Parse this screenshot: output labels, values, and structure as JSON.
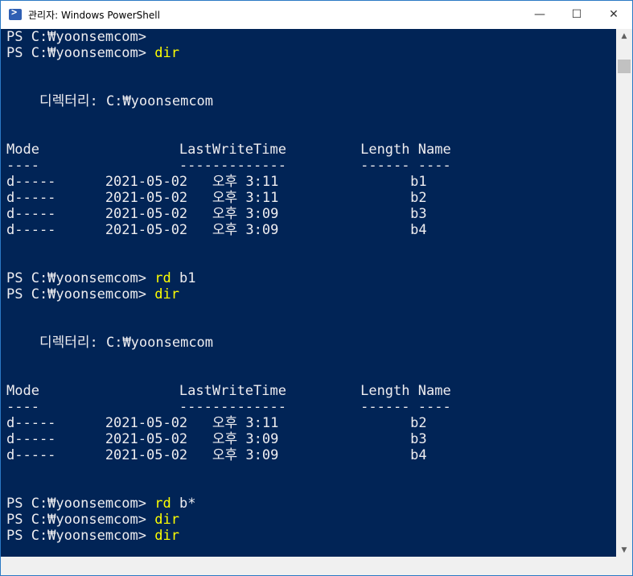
{
  "window": {
    "title": "관리자: Windows PowerShell",
    "controls": {
      "minimize": "—",
      "maximize": "☐",
      "close": "✕"
    }
  },
  "colors": {
    "console_bg": "#012456",
    "text": "#eeedf0",
    "command": "#ffff00"
  },
  "console": {
    "lines": [
      {
        "text": "PS C:₩yoonsemcom>",
        "cmd": ""
      },
      {
        "text": "PS C:₩yoonsemcom> ",
        "cmd": "dir"
      },
      {
        "text": "",
        "cmd": ""
      },
      {
        "text": "",
        "cmd": ""
      },
      {
        "text": "    디렉터리: C:₩yoonsemcom",
        "cmd": ""
      },
      {
        "text": "",
        "cmd": ""
      },
      {
        "text": "",
        "cmd": ""
      },
      {
        "text": "Mode                 LastWriteTime         Length Name",
        "cmd": ""
      },
      {
        "text": "----                 -------------         ------ ----",
        "cmd": ""
      },
      {
        "text": "d-----      2021-05-02   오후 3:11                b1",
        "cmd": ""
      },
      {
        "text": "d-----      2021-05-02   오후 3:11                b2",
        "cmd": ""
      },
      {
        "text": "d-----      2021-05-02   오후 3:09                b3",
        "cmd": ""
      },
      {
        "text": "d-----      2021-05-02   오후 3:09                b4",
        "cmd": ""
      },
      {
        "text": "",
        "cmd": ""
      },
      {
        "text": "",
        "cmd": ""
      },
      {
        "text": "PS C:₩yoonsemcom> ",
        "cmd": "rd",
        "arg": " b1"
      },
      {
        "text": "PS C:₩yoonsemcom> ",
        "cmd": "dir"
      },
      {
        "text": "",
        "cmd": ""
      },
      {
        "text": "",
        "cmd": ""
      },
      {
        "text": "    디렉터리: C:₩yoonsemcom",
        "cmd": ""
      },
      {
        "text": "",
        "cmd": ""
      },
      {
        "text": "",
        "cmd": ""
      },
      {
        "text": "Mode                 LastWriteTime         Length Name",
        "cmd": ""
      },
      {
        "text": "----                 -------------         ------ ----",
        "cmd": ""
      },
      {
        "text": "d-----      2021-05-02   오후 3:11                b2",
        "cmd": ""
      },
      {
        "text": "d-----      2021-05-02   오후 3:09                b3",
        "cmd": ""
      },
      {
        "text": "d-----      2021-05-02   오후 3:09                b4",
        "cmd": ""
      },
      {
        "text": "",
        "cmd": ""
      },
      {
        "text": "",
        "cmd": ""
      },
      {
        "text": "PS C:₩yoonsemcom> ",
        "cmd": "rd",
        "arg": " b*"
      },
      {
        "text": "PS C:₩yoonsemcom> ",
        "cmd": "dir"
      },
      {
        "text": "PS C:₩yoonsemcom> ",
        "cmd": "dir"
      }
    ]
  },
  "scrollbar": {
    "up_icon": "scroll-up-arrow-icon",
    "down_icon": "scroll-down-arrow-icon"
  }
}
